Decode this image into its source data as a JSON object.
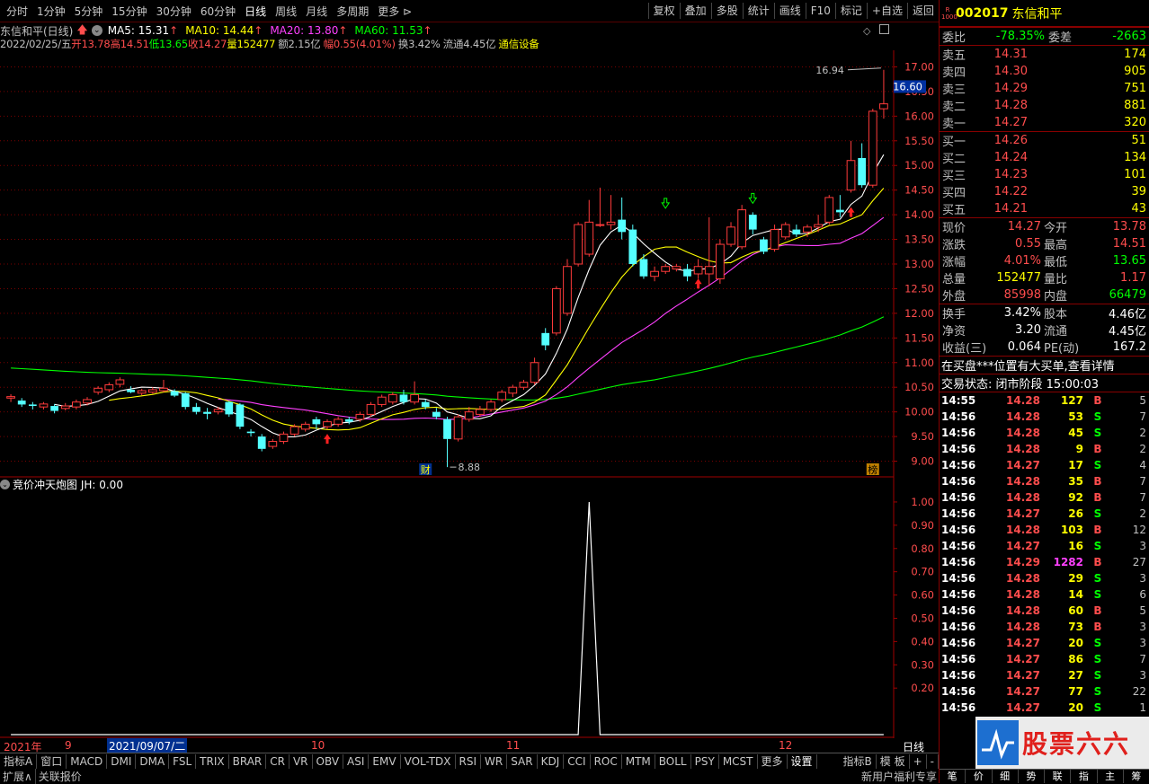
{
  "topbar": {
    "periods": [
      "分时",
      "1分钟",
      "5分钟",
      "15分钟",
      "30分钟",
      "60分钟",
      "日线",
      "周线",
      "月线",
      "多周期",
      "更多 ⊳"
    ],
    "active_period": "日线",
    "tools": [
      "复权",
      "叠加",
      "多股",
      "统计",
      "画线",
      "F10",
      "标记",
      "+自选",
      "返回"
    ]
  },
  "title": {
    "stock": "东信和平(日线)",
    "ma5": "MA5: 15.31",
    "ma10": "MA10: 14.44",
    "ma20": "MA20: 13.80",
    "ma60": "MA60: 11.53"
  },
  "info": {
    "date": "2022/02/25/五",
    "open": "开13.78",
    "high": "高14.51",
    "low": "低13.65",
    "close": "收14.27",
    "vol": "量152477",
    "amount": "额2.15亿",
    "change": "幅0.55(4.01%)",
    "turnover": "换3.42%",
    "float": "流通4.45亿",
    "sector": "通信设备"
  },
  "price_axis": {
    "labels": [
      "17.00",
      "16.50",
      "16.00",
      "15.50",
      "15.00",
      "14.50",
      "14.00",
      "13.50",
      "13.00",
      "12.50",
      "12.00",
      "11.50",
      "11.00",
      "10.50",
      "10.00",
      "9.50",
      "9.00"
    ],
    "current_label": "16.60",
    "max_label": "16.94",
    "min_label": "8.88",
    "marker_cai": "财",
    "marker_bang": "榜"
  },
  "indicator": {
    "title": "竞价冲天炮图  JH: 0.00",
    "axis": [
      "1.00",
      "0.90",
      "0.80",
      "0.70",
      "0.60",
      "0.50",
      "0.40",
      "0.30",
      "0.20"
    ]
  },
  "datebar": {
    "year": "2021年",
    "m9": "9",
    "cursor": "2021/09/07/二",
    "m10": "10",
    "m11": "11",
    "m12": "12",
    "period": "日线"
  },
  "bottombar": {
    "items": [
      "指标A",
      "窗口",
      "MACD",
      "DMI",
      "DMA",
      "FSL",
      "TRIX",
      "BRAR",
      "CR",
      "VR",
      "OBV",
      "ASI",
      "EMV",
      "VOL-TDX",
      "RSI",
      "WR",
      "SAR",
      "KDJ",
      "CCI",
      "ROC",
      "MTM",
      "BOLL",
      "PSY",
      "MCST",
      "更多",
      "设置"
    ],
    "right": [
      "指标B",
      "模 板",
      "+",
      "-"
    ]
  },
  "statusbar": {
    "left1": "扩展∧",
    "left2": "关联报价",
    "right": "新用户福利专享"
  },
  "right": {
    "code": "002017",
    "name": "东信和平",
    "weibi_label": "委比",
    "weibi": "-78.35%",
    "weicha_label": "委差",
    "weicha": "-2663",
    "asks": [
      {
        "label": "卖五",
        "price": "14.31",
        "vol": "174"
      },
      {
        "label": "卖四",
        "price": "14.30",
        "vol": "905"
      },
      {
        "label": "卖三",
        "price": "14.29",
        "vol": "751"
      },
      {
        "label": "卖二",
        "price": "14.28",
        "vol": "881"
      },
      {
        "label": "卖一",
        "price": "14.27",
        "vol": "320"
      }
    ],
    "bids": [
      {
        "label": "买一",
        "price": "14.26",
        "vol": "51"
      },
      {
        "label": "买二",
        "price": "14.24",
        "vol": "134"
      },
      {
        "label": "买三",
        "price": "14.23",
        "vol": "101"
      },
      {
        "label": "买四",
        "price": "14.22",
        "vol": "39"
      },
      {
        "label": "买五",
        "price": "14.21",
        "vol": "43"
      }
    ],
    "quote": [
      {
        "k1": "现价",
        "v1": "14.27",
        "c1": "red",
        "k2": "今开",
        "v2": "13.78",
        "c2": "red"
      },
      {
        "k1": "涨跌",
        "v1": "0.55",
        "c1": "red",
        "k2": "最高",
        "v2": "14.51",
        "c2": "red"
      },
      {
        "k1": "涨幅",
        "v1": "4.01%",
        "c1": "red",
        "k2": "最低",
        "v2": "13.65",
        "c2": "green"
      },
      {
        "k1": "总量",
        "v1": "152477",
        "c1": "yel",
        "k2": "量比",
        "v2": "1.17",
        "c2": "red"
      },
      {
        "k1": "外盘",
        "v1": "85998",
        "c1": "red",
        "k2": "内盘",
        "v2": "66479",
        "c2": "green"
      }
    ],
    "quote2": [
      {
        "k1": "换手",
        "v1": "3.42%",
        "k2": "股本",
        "v2": "4.46亿"
      },
      {
        "k1": "净资",
        "v1": "3.20",
        "k2": "流通",
        "v2": "4.45亿"
      },
      {
        "k1": "收益(三)",
        "v1": "0.064",
        "k2": "PE(动)",
        "v2": "167.2"
      }
    ],
    "notice": "在买盘***位置有大买单,查看详情",
    "trade_status": "交易状态: 闭市阶段 15:00:03",
    "ticks": [
      {
        "t": "14:55",
        "p": "14.28",
        "v": "127",
        "bs": "B",
        "n": "5"
      },
      {
        "t": "14:56",
        "p": "14.28",
        "v": "53",
        "bs": "S",
        "n": "7"
      },
      {
        "t": "14:56",
        "p": "14.28",
        "v": "45",
        "bs": "S",
        "n": "2"
      },
      {
        "t": "14:56",
        "p": "14.28",
        "v": "9",
        "bs": "B",
        "n": "2"
      },
      {
        "t": "14:56",
        "p": "14.27",
        "v": "17",
        "bs": "S",
        "n": "4"
      },
      {
        "t": "14:56",
        "p": "14.28",
        "v": "35",
        "bs": "B",
        "n": "7"
      },
      {
        "t": "14:56",
        "p": "14.28",
        "v": "92",
        "bs": "B",
        "n": "7"
      },
      {
        "t": "14:56",
        "p": "14.27",
        "v": "26",
        "bs": "S",
        "n": "2"
      },
      {
        "t": "14:56",
        "p": "14.28",
        "v": "103",
        "bs": "B",
        "n": "12"
      },
      {
        "t": "14:56",
        "p": "14.27",
        "v": "16",
        "bs": "S",
        "n": "3"
      },
      {
        "t": "14:56",
        "p": "14.29",
        "v": "1282",
        "bs": "B",
        "n": "27"
      },
      {
        "t": "14:56",
        "p": "14.28",
        "v": "29",
        "bs": "S",
        "n": "3"
      },
      {
        "t": "14:56",
        "p": "14.28",
        "v": "14",
        "bs": "S",
        "n": "6"
      },
      {
        "t": "14:56",
        "p": "14.28",
        "v": "60",
        "bs": "B",
        "n": "5"
      },
      {
        "t": "14:56",
        "p": "14.28",
        "v": "73",
        "bs": "B",
        "n": "3"
      },
      {
        "t": "14:56",
        "p": "14.27",
        "v": "20",
        "bs": "S",
        "n": "3"
      },
      {
        "t": "14:56",
        "p": "14.27",
        "v": "86",
        "bs": "S",
        "n": "7"
      },
      {
        "t": "14:56",
        "p": "14.27",
        "v": "27",
        "bs": "S",
        "n": "3"
      },
      {
        "t": "14:56",
        "p": "14.27",
        "v": "77",
        "bs": "S",
        "n": "22"
      },
      {
        "t": "14:56",
        "p": "14.27",
        "v": "20",
        "bs": "S",
        "n": "1"
      }
    ],
    "tabs": [
      "笔",
      "价",
      "细",
      "势",
      "联",
      "指",
      "主",
      "筹"
    ],
    "watermark_text": "股票六六"
  },
  "chart_data": [
    {
      "type": "candlestick",
      "title": "东信和平(日线)",
      "ylim": [
        8.7,
        17.3
      ],
      "candles": [
        [
          10.28,
          10.31,
          10.2,
          10.36
        ],
        [
          10.23,
          10.15,
          10.1,
          10.28
        ],
        [
          10.15,
          10.12,
          10.05,
          10.2
        ],
        [
          10.1,
          10.16,
          10.05,
          10.2
        ],
        [
          10.12,
          10.02,
          9.97,
          10.16
        ],
        [
          10.07,
          10.12,
          10.03,
          10.18
        ],
        [
          10.1,
          10.2,
          10.05,
          10.25
        ],
        [
          10.18,
          10.25,
          10.13,
          10.3
        ],
        [
          10.4,
          10.48,
          10.35,
          10.52
        ],
        [
          10.45,
          10.55,
          10.4,
          10.6
        ],
        [
          10.56,
          10.65,
          10.5,
          10.7
        ],
        [
          10.45,
          10.4,
          10.38,
          10.52
        ],
        [
          10.38,
          10.43,
          10.34,
          10.47
        ],
        [
          10.4,
          10.45,
          10.37,
          10.5
        ],
        [
          10.43,
          10.48,
          10.4,
          10.65
        ],
        [
          10.42,
          10.33,
          10.3,
          10.46
        ],
        [
          10.38,
          10.1,
          10.05,
          10.4
        ],
        [
          10.1,
          10.0,
          9.95,
          10.18
        ],
        [
          10.0,
          9.96,
          9.85,
          10.08
        ],
        [
          10.0,
          10.05,
          9.95,
          10.1
        ],
        [
          10.2,
          9.95,
          9.9,
          10.22
        ],
        [
          10.15,
          9.7,
          9.65,
          10.18
        ],
        [
          9.6,
          9.57,
          9.5,
          9.65
        ],
        [
          9.5,
          9.25,
          9.2,
          9.55
        ],
        [
          9.3,
          9.4,
          9.25,
          9.45
        ],
        [
          9.4,
          9.55,
          9.35,
          9.6
        ],
        [
          9.55,
          9.7,
          9.5,
          9.75
        ],
        [
          9.65,
          9.75,
          9.6,
          9.8
        ],
        [
          9.85,
          9.75,
          9.65,
          9.9
        ],
        [
          9.7,
          9.8,
          9.65,
          9.85
        ],
        [
          9.75,
          9.85,
          9.7,
          9.9
        ],
        [
          9.85,
          9.8,
          9.75,
          9.9
        ],
        [
          9.85,
          9.95,
          9.8,
          10.0
        ],
        [
          9.95,
          10.15,
          9.9,
          10.2
        ],
        [
          10.15,
          10.3,
          10.1,
          10.35
        ],
        [
          10.2,
          10.35,
          10.15,
          10.4
        ],
        [
          10.35,
          10.2,
          10.15,
          10.45
        ],
        [
          10.2,
          10.35,
          10.15,
          10.62
        ],
        [
          10.2,
          10.1,
          10.05,
          10.25
        ],
        [
          10.0,
          9.9,
          9.85,
          10.08
        ],
        [
          9.85,
          9.45,
          8.88,
          9.9
        ],
        [
          9.45,
          9.9,
          9.4,
          9.95
        ],
        [
          9.85,
          10.0,
          9.8,
          10.1
        ],
        [
          9.95,
          10.05,
          9.9,
          10.12
        ],
        [
          10.05,
          10.2,
          10.0,
          10.25
        ],
        [
          10.25,
          10.4,
          10.2,
          10.45
        ],
        [
          10.38,
          10.5,
          10.3,
          10.55
        ],
        [
          10.5,
          10.6,
          10.45,
          10.65
        ],
        [
          10.6,
          11.0,
          10.55,
          11.1
        ],
        [
          11.6,
          11.35,
          11.25,
          11.7
        ],
        [
          11.6,
          12.5,
          11.55,
          12.55
        ],
        [
          12.0,
          12.95,
          11.95,
          13.1
        ],
        [
          13.0,
          13.8,
          12.95,
          13.85
        ],
        [
          13.2,
          13.85,
          13.15,
          14.3
        ],
        [
          13.8,
          13.8,
          13.75,
          14.55
        ],
        [
          13.8,
          13.85,
          13.7,
          14.4
        ],
        [
          13.9,
          13.65,
          13.5,
          14.35
        ],
        [
          13.7,
          13.0,
          12.95,
          13.8
        ],
        [
          13.1,
          12.75,
          12.7,
          13.2
        ],
        [
          12.75,
          12.85,
          12.65,
          12.95
        ],
        [
          12.85,
          12.95,
          12.8,
          13.0
        ],
        [
          12.9,
          12.95,
          12.85,
          13.0
        ],
        [
          12.9,
          12.75,
          12.65,
          13.0
        ],
        [
          12.8,
          12.95,
          12.7,
          13.1
        ],
        [
          12.8,
          12.95,
          12.55,
          13.95
        ],
        [
          12.7,
          13.4,
          12.6,
          13.5
        ],
        [
          13.4,
          13.75,
          13.35,
          13.85
        ],
        [
          13.35,
          14.1,
          13.3,
          14.2
        ],
        [
          14.0,
          13.7,
          13.6,
          14.05
        ],
        [
          13.5,
          13.25,
          13.2,
          13.55
        ],
        [
          13.3,
          13.7,
          13.25,
          13.8
        ],
        [
          13.55,
          13.8,
          13.5,
          13.85
        ],
        [
          13.7,
          13.6,
          13.55,
          13.8
        ],
        [
          13.65,
          13.75,
          13.55,
          13.8
        ],
        [
          13.75,
          13.8,
          13.65,
          14.0
        ],
        [
          13.85,
          14.35,
          13.8,
          14.4
        ],
        [
          14.1,
          14.05,
          13.95,
          14.4
        ],
        [
          14.5,
          15.1,
          14.45,
          15.5
        ],
        [
          15.15,
          14.6,
          14.55,
          15.45
        ],
        [
          14.6,
          16.1,
          14.55,
          16.15
        ],
        [
          16.15,
          16.25,
          15.95,
          16.94
        ]
      ]
    },
    {
      "type": "line",
      "title": "竞价冲天炮图",
      "ylim": [
        0,
        1.05
      ],
      "peak_index": 53,
      "peak_value": 1.0
    }
  ],
  "colors": {
    "up": "#ff3b3b",
    "down": "#54ffff",
    "ma5": "#ffffff",
    "ma10": "#ffff00",
    "ma20": "#ff40ff",
    "ma60": "#00ff00",
    "grid": "#7a0000"
  }
}
